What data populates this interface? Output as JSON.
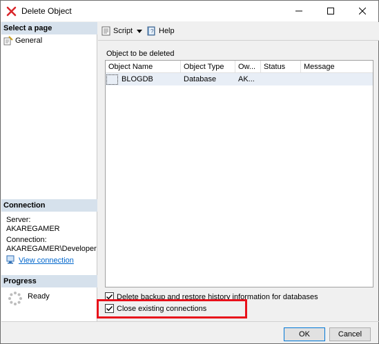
{
  "window": {
    "title": "Delete Object"
  },
  "left": {
    "select_page_header": "Select a page",
    "pages": [
      {
        "label": "General"
      }
    ],
    "connection_header": "Connection",
    "server_label": "Server:",
    "server_value": "AKAREGAMER",
    "connection_label": "Connection:",
    "connection_value": "AKAREGAMER\\Developer",
    "view_connection": "View connection",
    "progress_header": "Progress",
    "progress_status": "Ready"
  },
  "toolbar": {
    "script_label": "Script",
    "help_label": "Help"
  },
  "main": {
    "group_label": "Object to be deleted",
    "columns": [
      "Object Name",
      "Object Type",
      "Ow...",
      "Status",
      "Message"
    ],
    "rows": [
      {
        "name": "BLOGDB",
        "type": "Database",
        "owner": "AK...",
        "status": "",
        "message": ""
      }
    ],
    "checkbox_delete_backup": "Delete backup and restore history information for databases",
    "checkbox_close_connections": "Close existing connections",
    "delete_backup_checked": true,
    "close_connections_checked": true
  },
  "buttons": {
    "ok": "OK",
    "cancel": "Cancel"
  },
  "colors": {
    "highlight": "#e8101a",
    "section_header": "#d6e1ec",
    "link": "#0066cc"
  }
}
